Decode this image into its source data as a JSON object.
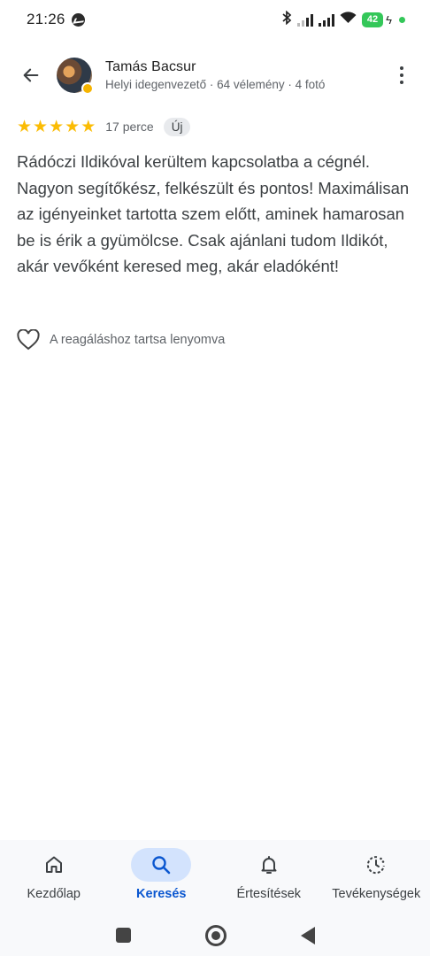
{
  "status_bar": {
    "time": "21:26",
    "battery": "42",
    "icons": [
      "messenger-icon",
      "bluetooth-icon",
      "signal-icon",
      "signal-icon",
      "wifi-icon",
      "battery-icon",
      "charging-icon"
    ]
  },
  "header": {
    "reviewer_name": "Tamás Bacsur",
    "reviewer_meta": "Helyi idegenvezető · 64 vélemény · 4 fotó"
  },
  "review": {
    "rating": 5,
    "stars": [
      "★",
      "★",
      "★",
      "★",
      "★"
    ],
    "time_ago": "17 perce",
    "badge": "Új",
    "text": "Rádóczi Ildikóval kerültem kapcsolatba a cégnél. Nagyon segítőkész, felkészült és pontos! Maximálisan az igényeinket tartotta szem előtt, aminek hamarosan be is érik a gyümölcse. Csak ajánlani tudom Ildikót, akár vevőként keresed meg, akár eladóként!"
  },
  "reaction": {
    "label": "A reagáláshoz tartsa lenyomva"
  },
  "bottom_nav": {
    "items": [
      {
        "label": "Kezdőlap",
        "icon": "home-icon",
        "active": false
      },
      {
        "label": "Keresés",
        "icon": "search-icon",
        "active": true
      },
      {
        "label": "Értesítések",
        "icon": "bell-icon",
        "active": false
      },
      {
        "label": "Tevékenységek",
        "icon": "activity-icon",
        "active": false
      }
    ]
  },
  "colors": {
    "star": "#fbbc04",
    "active_nav": "#0b57d0",
    "active_nav_bg": "#d3e3fd",
    "battery": "#34c759"
  }
}
